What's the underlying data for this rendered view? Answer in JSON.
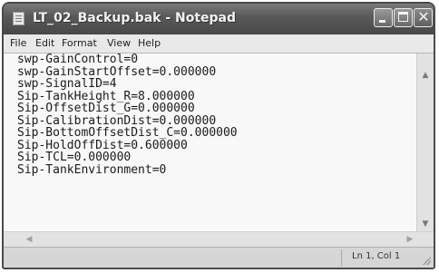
{
  "window": {
    "title": "LT_02_Backup.bak - Notepad",
    "close_glyph": "✕"
  },
  "menu": {
    "file": "File",
    "edit": "Edit",
    "format": "Format",
    "view": "View",
    "help": "Help"
  },
  "editor": {
    "lines": [
      "swp-GainControl=0",
      "swp-GainStartOffset=0.000000",
      "swp-SignalID=4",
      "Sip-TankHeight_R=8.000000",
      "Sip-OffsetDist_G=0.000000",
      "Sip-CalibrationDist=0.000000",
      "Sip-BottomOffsetDist_C=0.000000",
      "Sip-HoldOffDist=0.600000",
      "Sip-TCL=0.000000",
      "Sip-TankEnvironment=0"
    ]
  },
  "scrollbars": {
    "up": "▲",
    "down": "▼",
    "left": "◀",
    "right": "▶"
  },
  "status": {
    "position": "Ln 1, Col 1"
  },
  "icons": {
    "app": "notepad-icon",
    "minimize": "minimize-icon",
    "maximize": "maximize-icon",
    "close": "close-icon"
  }
}
